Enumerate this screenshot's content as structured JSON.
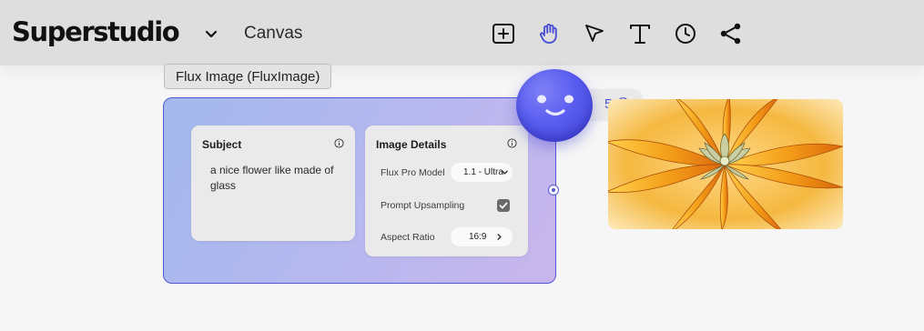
{
  "header": {
    "app_title": "Superstudio",
    "page_title": "Canvas",
    "tools": [
      {
        "name": "add-node",
        "icon": "plus-square-icon"
      },
      {
        "name": "pan",
        "icon": "hand-icon",
        "active": true
      },
      {
        "name": "select",
        "icon": "pointer-icon"
      },
      {
        "name": "text",
        "icon": "text-icon"
      },
      {
        "name": "history",
        "icon": "clock-icon"
      },
      {
        "name": "share",
        "icon": "share-icon"
      }
    ]
  },
  "node": {
    "tag_label": "Flux Image (FluxImage)",
    "subject": {
      "title": "Subject",
      "prompt": "a nice flower like made of glass"
    },
    "details": {
      "title": "Image Details",
      "model_label": "Flux Pro Model",
      "model_value": "1.1 - Ultra",
      "upsampling_label": "Prompt Upsampling",
      "upsampling_checked": true,
      "aspect_label": "Aspect Ratio",
      "aspect_value": "16:9"
    }
  },
  "credits": {
    "count": "5"
  },
  "colors": {
    "accent": "#5257d8",
    "node_gradient_start": "#a3b8ec",
    "node_gradient_end": "#c8b6ec",
    "topbar_bg": "#dedede",
    "canvas_bg": "#f6f6f6"
  }
}
